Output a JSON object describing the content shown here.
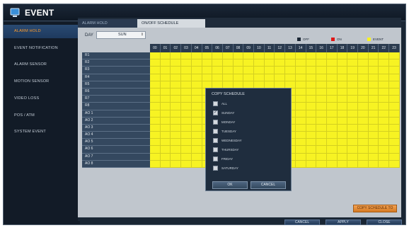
{
  "window": {
    "title": "EVENT",
    "icon": "event-monitor-icon"
  },
  "sidebar": {
    "items": [
      {
        "label": "ALARM HOLD",
        "active": true
      },
      {
        "label": "EVENT NOTIFICATION",
        "active": false
      },
      {
        "label": "ALARM SENSOR",
        "active": false
      },
      {
        "label": "MOTION SENSOR",
        "active": false
      },
      {
        "label": "VIDEO LOSS",
        "active": false
      },
      {
        "label": "POS / ATM",
        "active": false
      },
      {
        "label": "SYSTEM EVENT",
        "active": false
      }
    ]
  },
  "tabs": [
    {
      "label": "ALARM HOLD",
      "active": false
    },
    {
      "label": "ON/OFF SCHEDULE",
      "active": true
    }
  ],
  "schedule": {
    "day_label": "DAY",
    "day_value": "SUN",
    "legend": [
      {
        "label": "OFF",
        "color": "#1a2634"
      },
      {
        "label": "ON",
        "color": "#e01616"
      },
      {
        "label": "EVENT",
        "color": "#f7f323"
      }
    ],
    "hours": [
      "00",
      "01",
      "02",
      "03",
      "04",
      "05",
      "06",
      "07",
      "08",
      "09",
      "10",
      "11",
      "12",
      "13",
      "14",
      "15",
      "16",
      "17",
      "18",
      "19",
      "20",
      "21",
      "22",
      "23"
    ],
    "rows": [
      "R1",
      "R2",
      "R3",
      "R4",
      "R5",
      "R6",
      "R7",
      "R8",
      "AO 1",
      "AO 2",
      "AO 3",
      "AO 4",
      "AO 5",
      "AO 6",
      "AO 7",
      "AO 8"
    ],
    "cell_state": "EVENT",
    "copy_button": "COPY SCHEDULE TO"
  },
  "dialog": {
    "title": "COPY SCHEDULE",
    "options": [
      {
        "label": "ALL",
        "checked": false
      },
      {
        "label": "SUNDAY",
        "checked": true
      },
      {
        "label": "MONDAY",
        "checked": false
      },
      {
        "label": "TUESDAY",
        "checked": false
      },
      {
        "label": "WEDNESDAY",
        "checked": false
      },
      {
        "label": "THURSDAY",
        "checked": false
      },
      {
        "label": "FRIDAY",
        "checked": false
      },
      {
        "label": "SATURDAY",
        "checked": false
      }
    ],
    "ok": "OK",
    "cancel": "CANCEL"
  },
  "footer": {
    "cancel": "CANCEL",
    "apply": "APPLY",
    "close": "CLOSE"
  },
  "colors": {
    "accent": "#ff9b2a",
    "event": "#f7f323"
  }
}
